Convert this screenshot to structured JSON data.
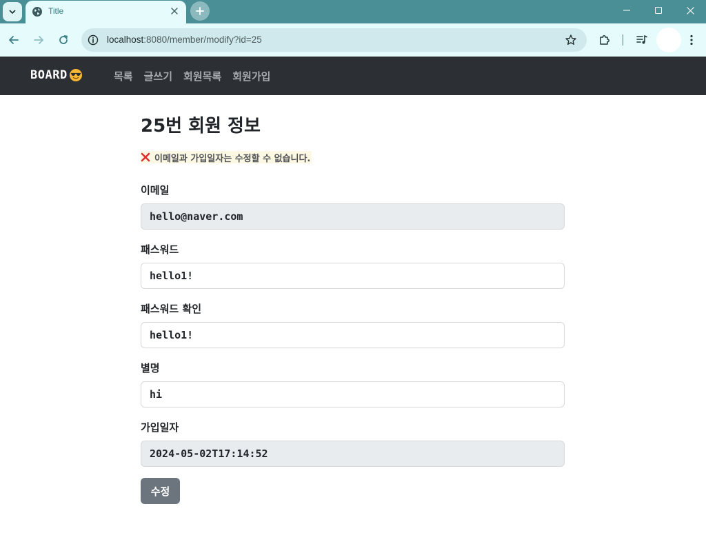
{
  "browser": {
    "tab_title": "Title",
    "url_host": "localhost",
    "url_path": ":8080/member/modify?id=25"
  },
  "navbar": {
    "brand": "BOARD",
    "links": [
      {
        "label": "목록"
      },
      {
        "label": "글쓰기"
      },
      {
        "label": "회원목록"
      },
      {
        "label": "회원가입"
      }
    ]
  },
  "page": {
    "title": "25번 회원 정보",
    "notice": "이메일과 가입일자는 수정할 수 없습니다.",
    "fields": {
      "email": {
        "label": "이메일",
        "value": "hello@naver.com"
      },
      "password": {
        "label": "패스워드",
        "value": "hello1!"
      },
      "password_confirm": {
        "label": "패스워드 확인",
        "value": "hello1!"
      },
      "nickname": {
        "label": "별명",
        "value": "hi"
      },
      "joined": {
        "label": "가입일자",
        "value": "2024-05-02T17:14:52"
      }
    },
    "submit_label": "수정"
  },
  "colors": {
    "browser_frame": "#4a8f96",
    "navbar_bg": "#2c3034",
    "notice_bg": "#fcf8e3",
    "readonly_bg": "#e9ecef",
    "button_bg": "#6c757d",
    "error_icon": "#e03131"
  },
  "icons": {
    "notice": "cross-mark-icon",
    "brand": "sunglasses-face-icon"
  }
}
